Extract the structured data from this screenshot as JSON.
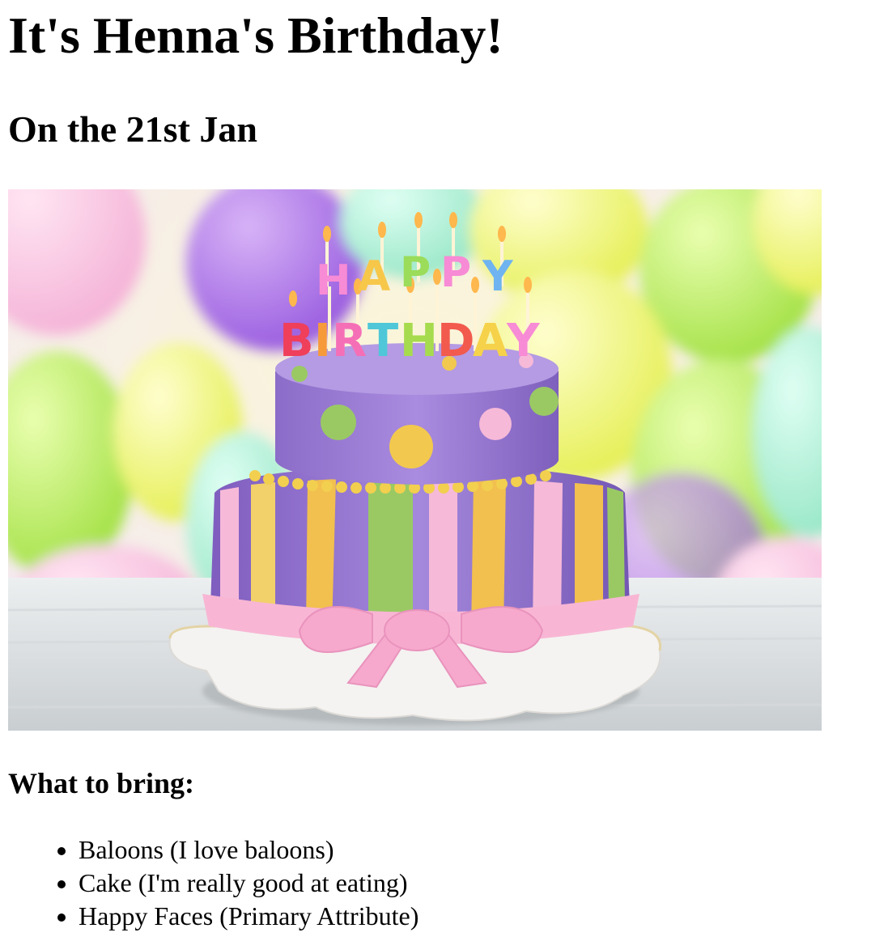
{
  "page": {
    "title": "It's Henna's Birthday!",
    "subtitle": "On the 21st Jan",
    "image": {
      "icon": "birthday-cake-photo",
      "description_text": "HAPPY BIRTHDAY"
    },
    "bring_heading": "What to bring:",
    "bring_items": [
      "Baloons (I love baloons)",
      "Cake (I'm really good at eating)",
      "Happy Faces (Primary Attribute)"
    ]
  }
}
